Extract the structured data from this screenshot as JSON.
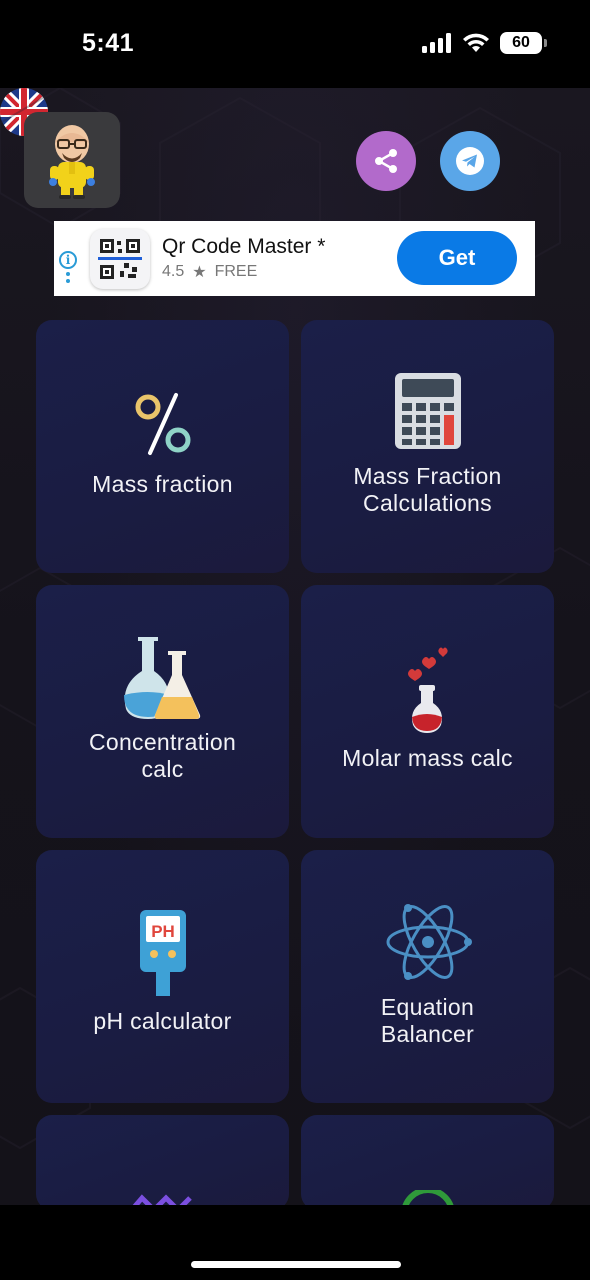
{
  "status_bar": {
    "time": "5:41",
    "battery": "60"
  },
  "header": {
    "avatar_icon": "cartoon-chemist-avatar",
    "share_icon": "share-icon",
    "telegram_icon": "telegram-icon",
    "language_icon": "uk-flag-icon",
    "colors": {
      "share": "#b26acb",
      "telegram": "#5aa6e8"
    }
  },
  "ad": {
    "title": "Qr Code Master *",
    "rating": "4.5",
    "price": "FREE",
    "button": "Get",
    "accent": "#0a7ae6"
  },
  "cards": [
    {
      "label": "Mass fraction",
      "icon": "percent-icon"
    },
    {
      "label": "Mass Fraction\nCalculations",
      "icon": "calculator-icon"
    },
    {
      "label": "Concentration\ncalc",
      "icon": "flasks-icon"
    },
    {
      "label": "Molar mass calc",
      "icon": "love-potion-icon"
    },
    {
      "label": "pH calculator",
      "icon": "ph-meter-icon"
    },
    {
      "label": "Equation\nBalancer",
      "icon": "atom-icon"
    }
  ]
}
